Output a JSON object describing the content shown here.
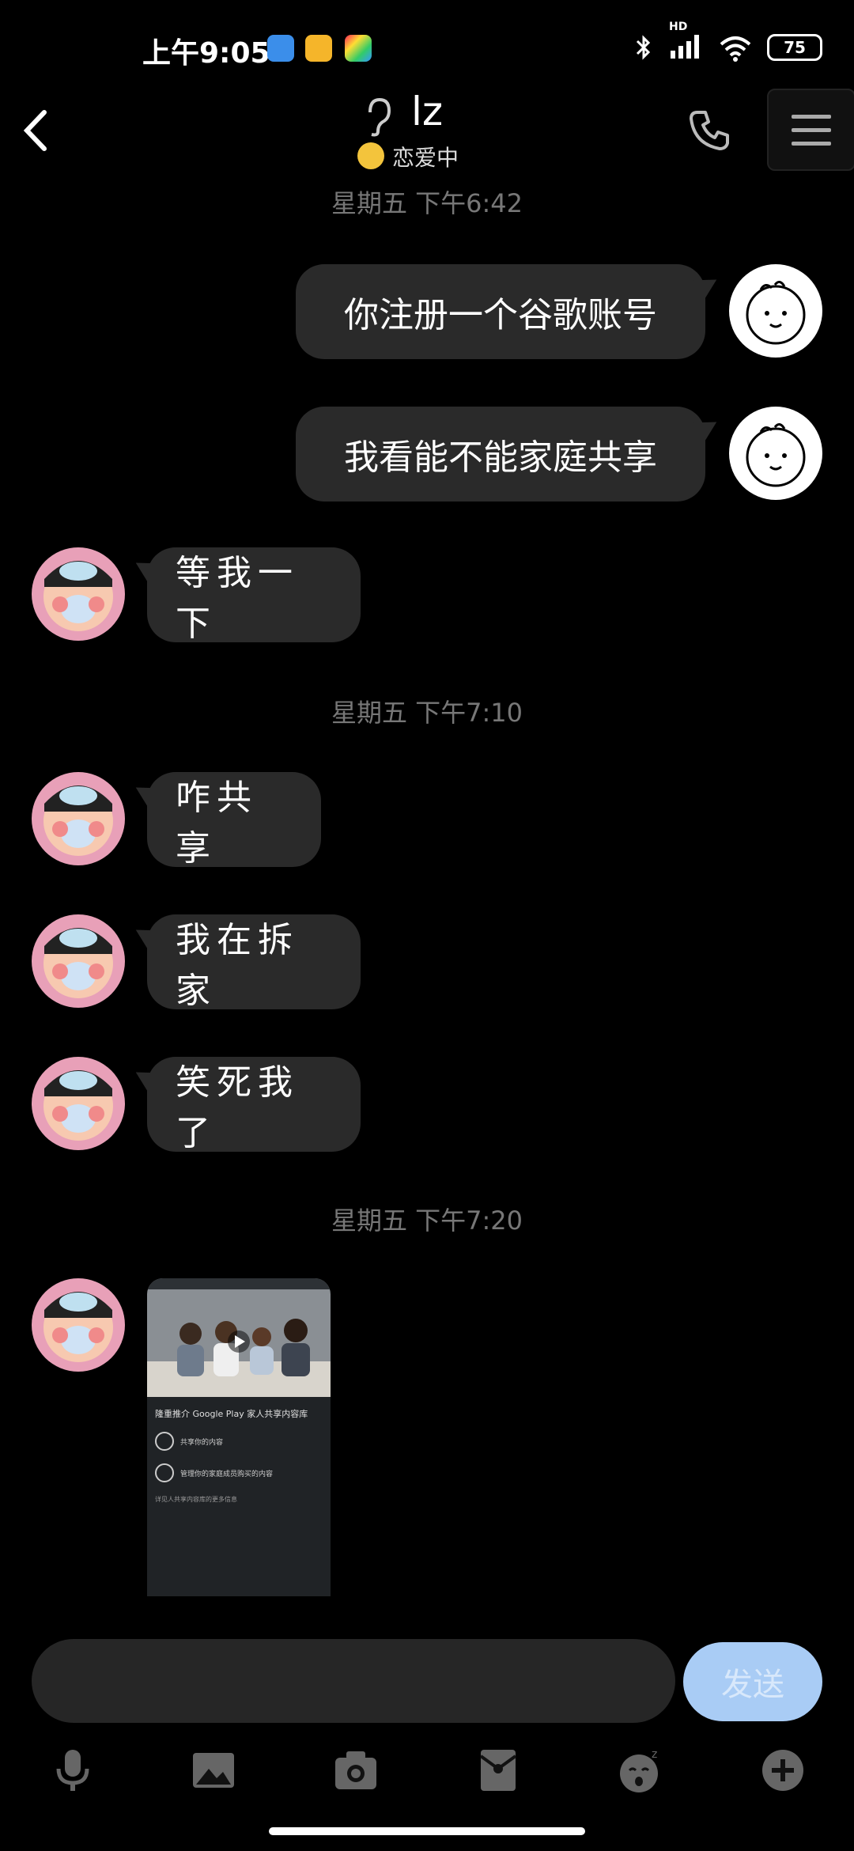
{
  "status_bar": {
    "time": "上午9:05",
    "battery": "75",
    "network": "HD"
  },
  "header": {
    "title": "lz",
    "subtitle": "恋爱中"
  },
  "messages": [
    {
      "timestamp": "星期五 下午6:42"
    },
    {
      "side": "right",
      "text": "你注册一个谷歌账号"
    },
    {
      "side": "right",
      "text": "我看能不能家庭共享"
    },
    {
      "side": "left",
      "text": "等我一下"
    },
    {
      "timestamp": "星期五 下午7:10"
    },
    {
      "side": "left",
      "text": "咋共享"
    },
    {
      "side": "left",
      "text": "我在拆家"
    },
    {
      "side": "left",
      "text": "笑死我了"
    },
    {
      "timestamp": "星期五 下午7:20"
    },
    {
      "side": "left",
      "type": "image"
    }
  ],
  "timestamps": [
    "星期五 下午6:42",
    "星期五 下午7:10",
    "星期五 下午7:20"
  ],
  "bubbles": {
    "m1": "你注册一个谷歌账号",
    "m2": "我看能不能家庭共享",
    "m3": "等我一下",
    "m4": "咋共享",
    "m5": "我在拆家",
    "m6": "笑死我了"
  },
  "image_message": {
    "heading": "隆重推介 Google Play 家人共享内容库",
    "item1": "共享你的内容",
    "item2": "管理你的家庭成员购买的内容",
    "footer_text": "详见人共享内容库的更多信息"
  },
  "input": {
    "placeholder": "",
    "send_label": "发送"
  },
  "toolbar": [
    "mic-icon",
    "image-icon",
    "camera-icon",
    "red-packet-icon",
    "emoji-icon",
    "add-icon"
  ],
  "colors": {
    "bubble": "#2a2a2a",
    "send_button": "#a9ccf5",
    "timestamp": "#777777"
  }
}
